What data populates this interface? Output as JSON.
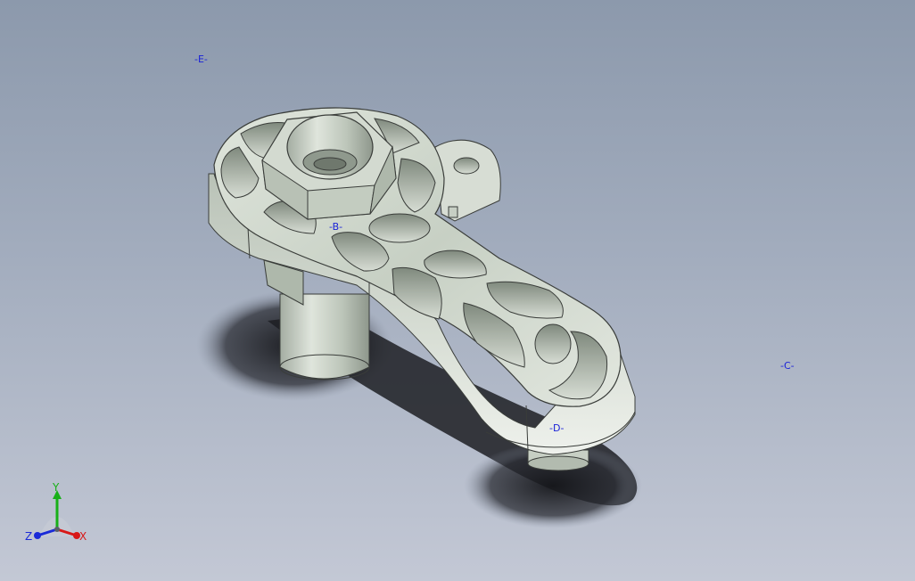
{
  "viewport": {
    "background_top": "#8c99ac",
    "background_bottom": "#c3c8d5",
    "model_color": "#c9d1c8",
    "model_edge_color": "#3a3d3a",
    "shadow_color": "#1e1f24"
  },
  "annotations": {
    "e": "-E-",
    "b": "-B-",
    "c": "-C-",
    "d": "-D-",
    "color": "#1a22d8"
  },
  "triad": {
    "x_label": "X",
    "y_label": "Y",
    "z_label": "Z",
    "x_color": "#d81818",
    "y_color": "#18b018",
    "z_color": "#1a2ad8"
  }
}
